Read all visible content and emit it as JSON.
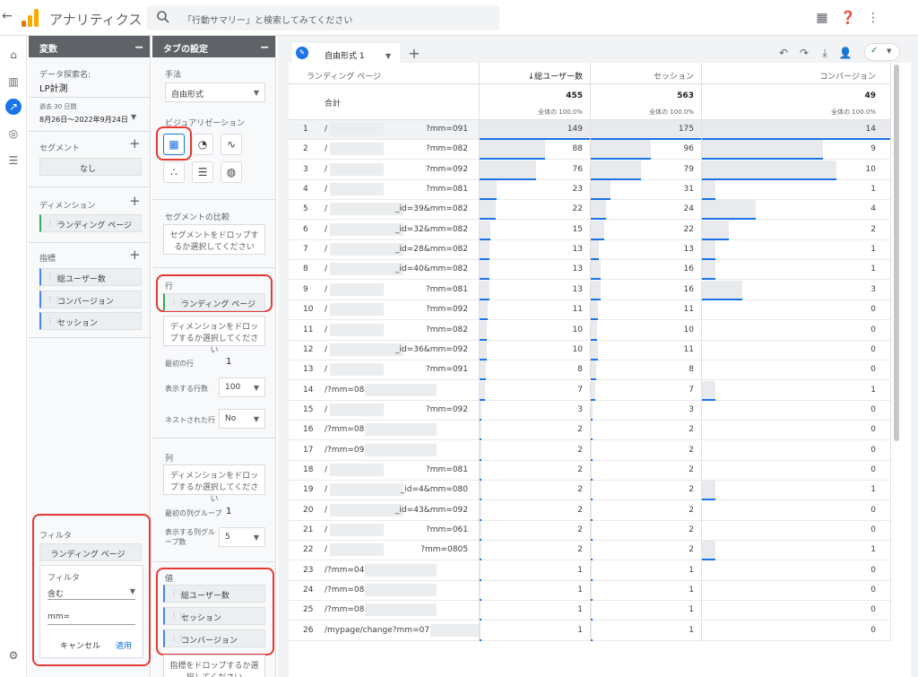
{
  "app": {
    "title": "アナリティクス"
  },
  "search": {
    "placeholder": "「行動サマリー」と検索してみてください"
  },
  "variables_panel": {
    "header": "変数",
    "exploration_label": "データ探索名:",
    "exploration_name": "LP計測",
    "date_badge": "過去 30 日間",
    "date_range": "8月26日～2022年9月24日",
    "segment_label": "セグメント",
    "segment_value": "なし",
    "dimension_label": "ディメンション",
    "dimensions": [
      "ランディング ページ"
    ],
    "metrics_label": "指標",
    "metrics": [
      "総ユーザー数",
      "コンバージョン",
      "セッション"
    ]
  },
  "filter": {
    "title": "フィルタ",
    "dimension": "ランディング ページ",
    "sub_label": "フィルタ",
    "operator": "含む",
    "value": "mm=",
    "cancel": "キャンセル",
    "apply": "適用"
  },
  "tab_settings": {
    "header": "タブの設定",
    "technique_label": "手法",
    "technique_value": "自由形式",
    "viz_label": "ビジュアリゼーション",
    "seg_compare_label": "セグメントの比較",
    "seg_drop": "セグメントをドロップするか選択してください",
    "rows_label": "行",
    "row_chip": "ランディング ページ",
    "row_drop": "ディメンションをドロップするか選択してください",
    "first_row_label": "最初の行",
    "first_row_value": "1",
    "show_rows_label": "表示する行数",
    "show_rows_value": "100",
    "nested_label": "ネストされた行",
    "nested_value": "No",
    "cols_label": "列",
    "col_drop": "ディメンションをドロップするか選択してください",
    "first_col_label": "最初の列グループ",
    "first_col_value": "1",
    "show_cols_label": "表示する列グループ数",
    "show_cols_value": "5",
    "values_label": "値",
    "values": [
      "総ユーザー数",
      "セッション",
      "コンバージョン"
    ],
    "metric_drop": "指標をドロップするか選択してください"
  },
  "main": {
    "tab_label": "自由形式 1",
    "columns": {
      "dim": "ランディング ページ",
      "users": "↓総ユーザー数",
      "sessions": "セッション",
      "conversions": "コンバージョン"
    },
    "total_label": "合計",
    "totals": {
      "users": "455",
      "sessions": "563",
      "conversions": "49"
    },
    "total_pct": "全体の 100.0%",
    "rows": [
      {
        "no": "1",
        "page": "/",
        "suffix": "?mm=091",
        "users": "149",
        "sessions": "175",
        "conversions": "14"
      },
      {
        "no": "2",
        "page": "/",
        "suffix": "?mm=082",
        "users": "88",
        "sessions": "96",
        "conversions": "9"
      },
      {
        "no": "3",
        "page": "/",
        "suffix": "?mm=092",
        "users": "76",
        "sessions": "79",
        "conversions": "10"
      },
      {
        "no": "4",
        "page": "/",
        "suffix": "?mm=081",
        "users": "23",
        "sessions": "31",
        "conversions": "1"
      },
      {
        "no": "5",
        "page": "/",
        "suffix": "_id=39&mm=082",
        "users": "22",
        "sessions": "24",
        "conversions": "4"
      },
      {
        "no": "6",
        "page": "/",
        "suffix": "_id=32&mm=082",
        "users": "15",
        "sessions": "22",
        "conversions": "2"
      },
      {
        "no": "7",
        "page": "/",
        "suffix": "_id=28&mm=082",
        "users": "13",
        "sessions": "13",
        "conversions": "1"
      },
      {
        "no": "8",
        "page": "/",
        "suffix": "_id=40&mm=082",
        "users": "13",
        "sessions": "16",
        "conversions": "1"
      },
      {
        "no": "9",
        "page": "/",
        "suffix": "?mm=081",
        "users": "13",
        "sessions": "16",
        "conversions": "3"
      },
      {
        "no": "10",
        "page": "/",
        "suffix": "?mm=092",
        "users": "11",
        "sessions": "11",
        "conversions": "0"
      },
      {
        "no": "11",
        "page": "/",
        "suffix": "?mm=082",
        "users": "10",
        "sessions": "10",
        "conversions": "0"
      },
      {
        "no": "12",
        "page": "/",
        "suffix": "_id=36&mm=092",
        "users": "10",
        "sessions": "11",
        "conversions": "0"
      },
      {
        "no": "13",
        "page": "/",
        "suffix": "?mm=091",
        "users": "8",
        "sessions": "8",
        "conversions": "0"
      },
      {
        "no": "14",
        "page": "/?mm=082",
        "suffix": "",
        "users": "7",
        "sessions": "7",
        "conversions": "1"
      },
      {
        "no": "15",
        "page": "/",
        "suffix": "?mm=092",
        "users": "3",
        "sessions": "3",
        "conversions": "0"
      },
      {
        "no": "16",
        "page": "/?mm=081",
        "suffix": "",
        "users": "2",
        "sessions": "2",
        "conversions": "0"
      },
      {
        "no": "17",
        "page": "/?mm=092",
        "suffix": "",
        "users": "2",
        "sessions": "2",
        "conversions": "0"
      },
      {
        "no": "18",
        "page": "/",
        "suffix": "?mm=081",
        "users": "2",
        "sessions": "2",
        "conversions": "0"
      },
      {
        "no": "19",
        "page": "/",
        "suffix": "_id=4&mm=080",
        "users": "2",
        "sessions": "2",
        "conversions": "1"
      },
      {
        "no": "20",
        "page": "/",
        "suffix": "_id=43&mm=092",
        "users": "2",
        "sessions": "2",
        "conversions": "0"
      },
      {
        "no": "21",
        "page": "/",
        "suffix": "?mm=061",
        "users": "2",
        "sessions": "2",
        "conversions": "0"
      },
      {
        "no": "22",
        "page": "/",
        "suffix": "?mm=0805",
        "users": "2",
        "sessions": "2",
        "conversions": "1"
      },
      {
        "no": "23",
        "page": "/?mm=041",
        "suffix": "",
        "users": "1",
        "sessions": "1",
        "conversions": "0"
      },
      {
        "no": "24",
        "page": "/?mm=080",
        "suffix": "",
        "users": "1",
        "sessions": "1",
        "conversions": "0"
      },
      {
        "no": "25",
        "page": "/?mm=081",
        "suffix": "",
        "users": "1",
        "sessions": "1",
        "conversions": "0"
      },
      {
        "no": "26",
        "page": "/mypage/change?mm=071",
        "suffix": "",
        "users": "1",
        "sessions": "1",
        "conversions": "0"
      }
    ]
  }
}
